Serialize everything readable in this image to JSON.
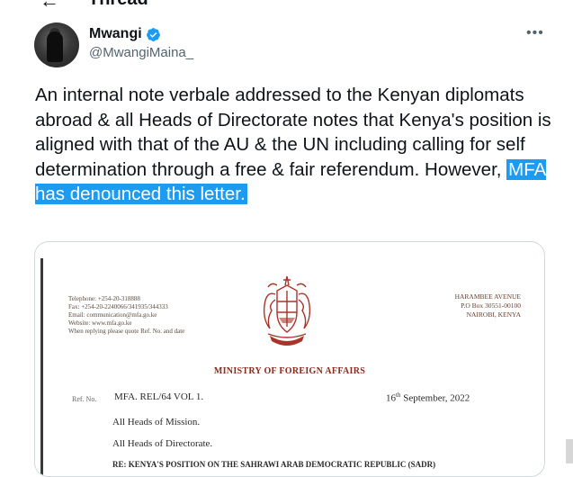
{
  "header": {
    "title": "Thread"
  },
  "tweet": {
    "author_name": "Mwangi",
    "author_handle": "@MwangiMaina_",
    "text_plain": "An internal note verbale addressed to the Kenyan diplomats abroad & all Heads of Directorate notes that Kenya's position is aligned with that of the AU & the UN including calling for self determination through a free & fair referendum. However, ",
    "text_highlight": "MFA has denounced this letter.",
    "verified_color": "#1d9bf0",
    "highlight_color": "#1d9bf0"
  },
  "document": {
    "contact_lines": [
      "Telephone: +254-20-318888",
      "Fax: +254-20-2240066/341935/344333",
      "Email: communication@mfa.go.ke",
      "Website: www.mfa.go.ke",
      "When replying please quote Ref. No. and date"
    ],
    "address_lines": [
      "HARAMBEE AVENUE",
      "P.O Box 30551-00100",
      "NAIROBI, KENYA"
    ],
    "ministry": "MINISTRY OF FOREIGN AFFAIRS",
    "ref_label": "Ref. No.",
    "ref_value": "MFA. REL/64 VOL 1.",
    "date_day": "16",
    "date_suffix": "th",
    "date_rest": " September, 2022",
    "recipient_1": "All Heads of Mission.",
    "recipient_2": "All Heads of Directorate.",
    "subject": "RE: KENYA'S POSITION ON THE SAHRAWI ARAB DEMOCRATIC REPUBLIC (SADR)"
  }
}
